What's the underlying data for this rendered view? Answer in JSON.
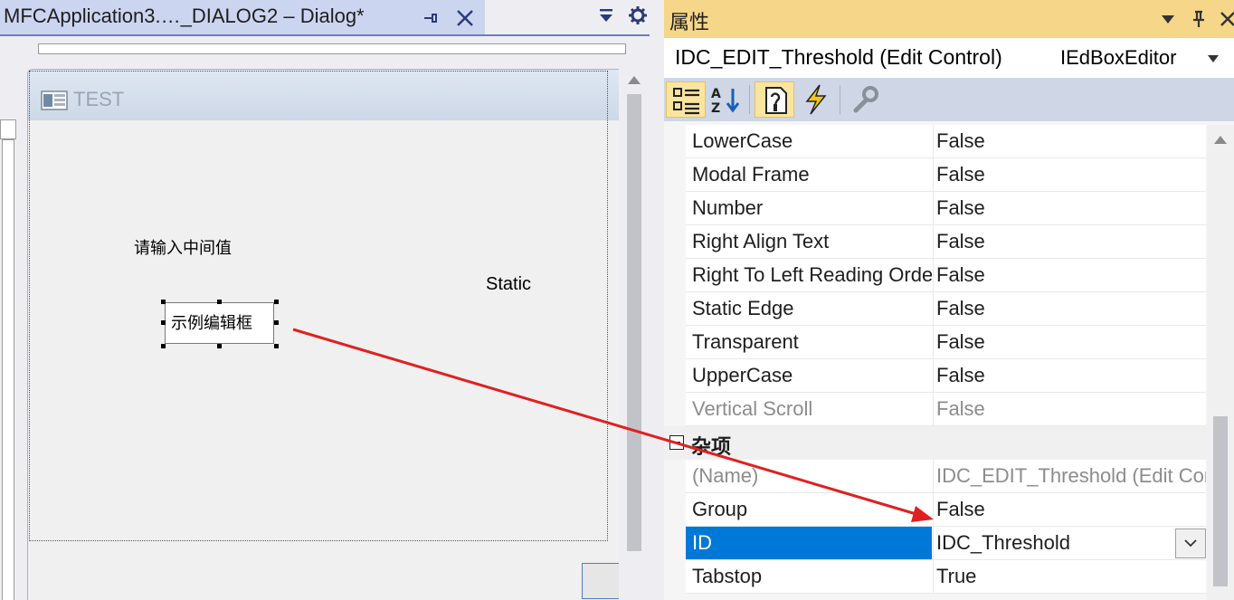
{
  "editor": {
    "tab_title": "MFCApplication3.…_DIALOG2 – Dialog*",
    "dialog_caption": "TEST",
    "label_prompt": "请输入中间值",
    "label_static": "Static",
    "edit_text": "示例编辑框"
  },
  "properties": {
    "pane_title": "属性",
    "object_name": "IDC_EDIT_Threshold (Edit Control)",
    "object_type": "IEdBoxEditor",
    "rows": [
      {
        "name": "LowerCase",
        "value": "False"
      },
      {
        "name": "Modal Frame",
        "value": "False"
      },
      {
        "name": "Number",
        "value": "False"
      },
      {
        "name": "Right Align Text",
        "value": "False"
      },
      {
        "name": "Right To Left Reading Order",
        "value": "False"
      },
      {
        "name": "Static Edge",
        "value": "False"
      },
      {
        "name": "Transparent",
        "value": "False"
      },
      {
        "name": "UpperCase",
        "value": "False"
      },
      {
        "name": "Vertical Scroll",
        "value": "False"
      }
    ],
    "category": "杂项",
    "misc_rows": [
      {
        "name": "(Name)",
        "value": "IDC_EDIT_Threshold (Edit Control)"
      },
      {
        "name": "Group",
        "value": "False"
      },
      {
        "name": "ID",
        "value": "IDC_Threshold"
      },
      {
        "name": "Tabstop",
        "value": "True"
      }
    ]
  },
  "colors": {
    "selection": "#0078d7",
    "header": "#f6d688",
    "annotation_arrow": "#e02020"
  }
}
